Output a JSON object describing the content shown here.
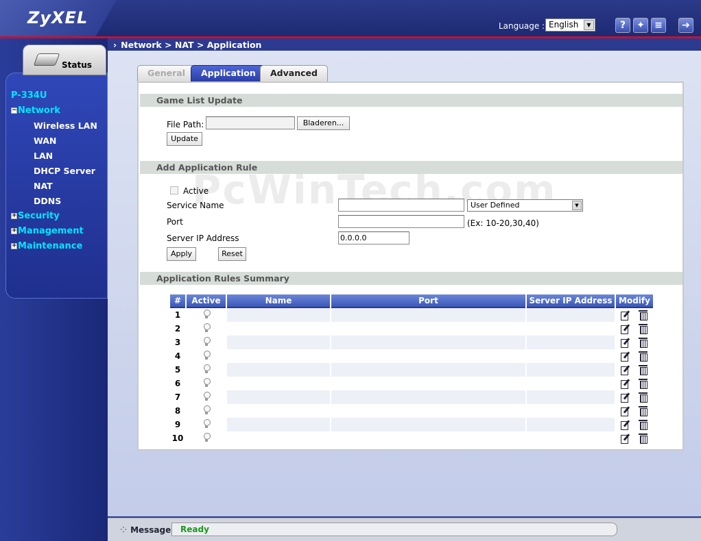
{
  "header": {
    "brand": "ZyXEL",
    "language_label": "Language :",
    "language_value": "English",
    "icons": [
      "help-icon",
      "wizard-icon",
      "about-icon",
      "logout-icon"
    ]
  },
  "sidebar": {
    "status_label": "Status",
    "device": "P-334U",
    "items": [
      {
        "label": "Network",
        "type": "group",
        "expanded": true
      },
      {
        "label": "Wireless LAN",
        "type": "sub"
      },
      {
        "label": "WAN",
        "type": "sub"
      },
      {
        "label": "LAN",
        "type": "sub"
      },
      {
        "label": "DHCP Server",
        "type": "sub"
      },
      {
        "label": "NAT",
        "type": "sub"
      },
      {
        "label": "DDNS",
        "type": "sub"
      },
      {
        "label": "Security",
        "type": "group",
        "expanded": false
      },
      {
        "label": "Management",
        "type": "group",
        "expanded": false
      },
      {
        "label": "Maintenance",
        "type": "group",
        "expanded": false
      }
    ]
  },
  "breadcrumb": "Network > NAT > Application",
  "tabs": [
    {
      "label": "General",
      "state": "disabled"
    },
    {
      "label": "Application",
      "state": "active"
    },
    {
      "label": "Advanced",
      "state": "normal"
    }
  ],
  "game_list": {
    "title": "Game List Update",
    "file_path_label": "File Path:",
    "file_path_value": "",
    "browse_label": "Bladeren...",
    "update_label": "Update"
  },
  "app_rule": {
    "title": "Add Application Rule",
    "active_label": "Active",
    "service_name_label": "Service Name",
    "service_name_value": "",
    "service_select": "User Defined",
    "port_label": "Port",
    "port_value": "",
    "port_hint": "(Ex: 10-20,30,40)",
    "server_ip_label": "Server IP Address",
    "server_ip_value": "0.0.0.0",
    "apply_label": "Apply",
    "reset_label": "Reset"
  },
  "summary": {
    "title": "Application Rules Summary",
    "columns": [
      "#",
      "Active",
      "Name",
      "Port",
      "Server IP Address",
      "Modify"
    ],
    "rows": [
      "1",
      "2",
      "3",
      "4",
      "5",
      "6",
      "7",
      "8",
      "9",
      "10"
    ]
  },
  "watermark": "PcWinTech.com",
  "footer": {
    "message_label": "Message",
    "message_value": "Ready"
  }
}
